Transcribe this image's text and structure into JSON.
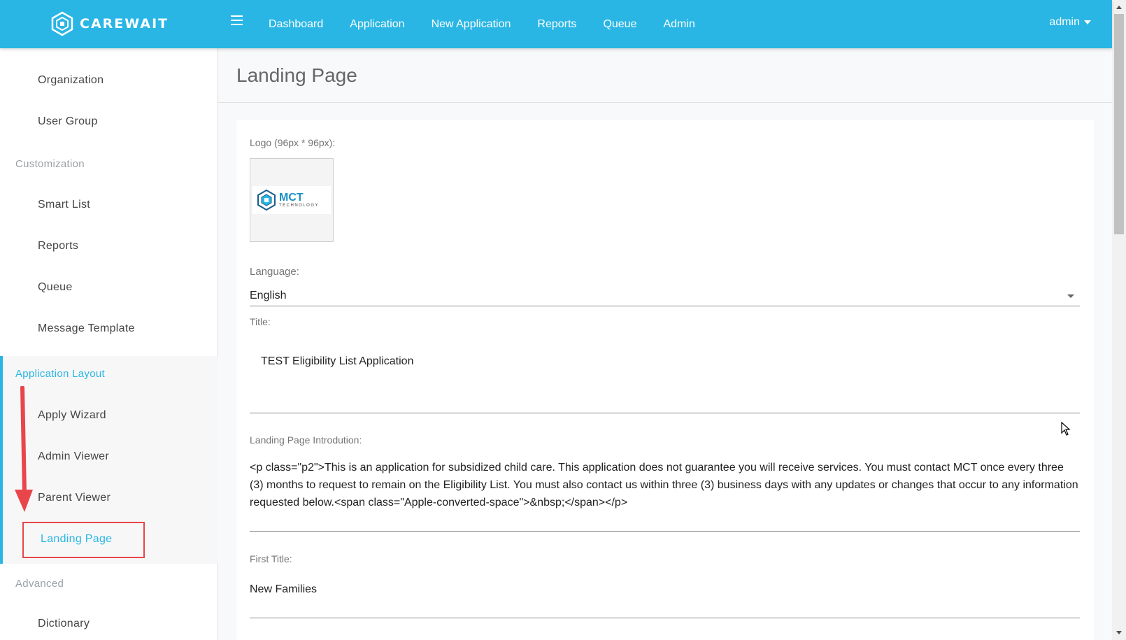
{
  "brand": {
    "name": "CAREWAIT"
  },
  "nav": {
    "items": [
      {
        "label": "Dashboard"
      },
      {
        "label": "Application"
      },
      {
        "label": "New Application"
      },
      {
        "label": "Reports"
      },
      {
        "label": "Queue"
      },
      {
        "label": "Admin"
      }
    ],
    "user": "admin"
  },
  "sidebar": {
    "items": {
      "organization": "Organization",
      "user_group": "User Group",
      "customization": "Customization",
      "smart_list": "Smart List",
      "reports": "Reports",
      "queue": "Queue",
      "message_template": "Message Template",
      "application_layout": "Application Layout",
      "apply_wizard": "Apply Wizard",
      "admin_viewer": "Admin Viewer",
      "parent_viewer": "Parent Viewer",
      "landing_page": "Landing Page",
      "advanced": "Advanced",
      "dictionary": "Dictionary"
    }
  },
  "page": {
    "title": "Landing Page"
  },
  "form": {
    "logo_label": "Logo (96px * 96px):",
    "logo": {
      "word": "MCT",
      "tagline": "TECHNOLOGY"
    },
    "language_label": "Language:",
    "language_value": "English",
    "title_label": "Title:",
    "title_value": "TEST Eligibility List Application",
    "intro_label": "Landing Page Introdution:",
    "intro_value": "<p class=\"p2\">This is an application for subsidized child care. This application does not guarantee you will receive services. You must contact MCT once every three (3) months to request to remain on the Eligibility List. You must also contact us within three (3) business days with any updates or changes that occur to any information requested below.<span class=\"Apple-converted-space\">&nbsp;</span></p>",
    "first_title_label": "First Title:",
    "first_title_value": "New Families"
  },
  "colors": {
    "topbar": "#29b6e4",
    "accent": "#29b6e4",
    "highlight": "#e8464a"
  }
}
